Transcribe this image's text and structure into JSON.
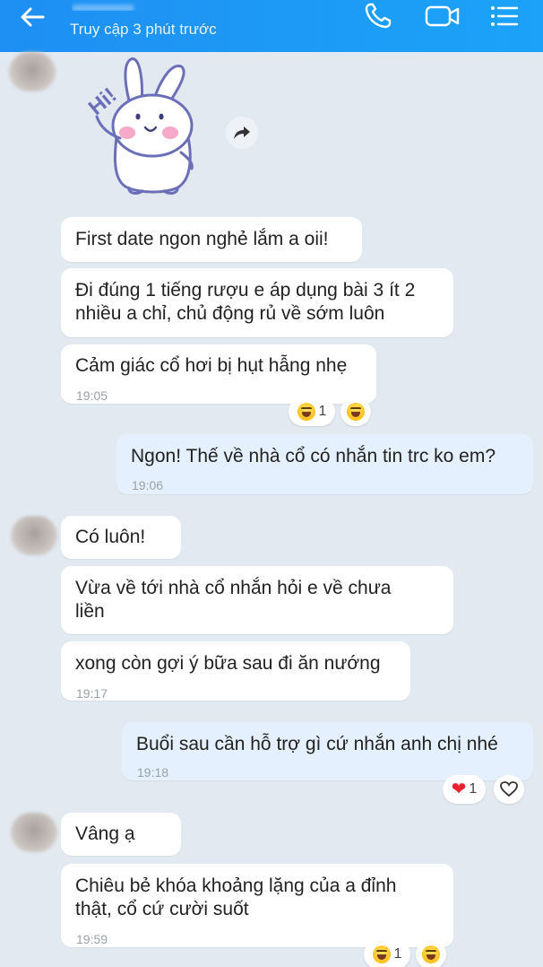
{
  "header": {
    "status": "Truy cập 3 phút trước"
  },
  "colors": {
    "header": "#1f8ff3",
    "chat_bg": "#e2e9f1",
    "incoming": "#ffffff",
    "outgoing": "#e4f0fe"
  },
  "sticker": {
    "text": "Hi!"
  },
  "messages": [
    {
      "text": "First date ngon nghẻ lắm a oii!"
    },
    {
      "text": "Đi đúng 1 tiếng rượu e áp dụng bài 3 ít 2 nhiều a chỉ, chủ động rủ về sớm luôn"
    },
    {
      "text": "Cảm giác cổ hơi bị hụt hẫng nhẹ",
      "time": "19:05"
    },
    {
      "text": "Ngon! Thế về nhà cổ có nhắn tin trc ko em?",
      "time": "19:06"
    },
    {
      "text": "Có luôn!"
    },
    {
      "text": "Vừa về tới nhà cổ nhắn hỏi e về chưa liền"
    },
    {
      "text": "xong còn gợi ý bữa sau đi ăn nướng",
      "time": "19:17"
    },
    {
      "text": "Buổi sau cần hỗ trợ gì cứ nhắn anh chị nhé",
      "time": "19:18"
    },
    {
      "text": "Vâng ạ"
    },
    {
      "text": "Chiêu bẻ khóa khoảng lặng của a đỉnh thật, cổ cứ cười suốt",
      "time": "19:59"
    }
  ],
  "reactions": {
    "r1_count": "1",
    "r2_count": "1",
    "r3_count": "1"
  }
}
